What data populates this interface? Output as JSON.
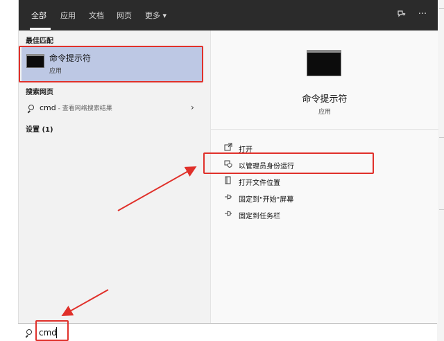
{
  "tabs": [
    {
      "label": "全部",
      "active": true
    },
    {
      "label": "应用"
    },
    {
      "label": "文档"
    },
    {
      "label": "网页"
    },
    {
      "label": "更多 ▾"
    }
  ],
  "topbar_icons": [
    "feedback-icon",
    "more-icon"
  ],
  "sections": {
    "best_match": "最佳匹配",
    "web_search": "搜索网页",
    "settings": "设置 (1)"
  },
  "best_match": {
    "name": "命令提示符",
    "type": "应用",
    "icon": "terminal-icon"
  },
  "web_result": {
    "query": "cmd",
    "hint": " - 查看网络搜索结果"
  },
  "app_detail": {
    "title": "命令提示符",
    "subtitle": "应用",
    "icon": "terminal-icon"
  },
  "actions": [
    {
      "label": "打开",
      "icon": "open-icon"
    },
    {
      "label": "以管理员身份运行",
      "icon": "admin-shield-icon"
    },
    {
      "label": "打开文件位置",
      "icon": "file-location-icon"
    },
    {
      "label": "固定到\"开始\"屏幕",
      "icon": "pin-start-icon"
    },
    {
      "label": "固定到任务栏",
      "icon": "pin-taskbar-icon"
    }
  ],
  "search": {
    "value": "cmd"
  },
  "colors": {
    "accent_selection": "#bdc8e4",
    "highlight": "#e0302a",
    "topbar": "#2b2b2b"
  }
}
